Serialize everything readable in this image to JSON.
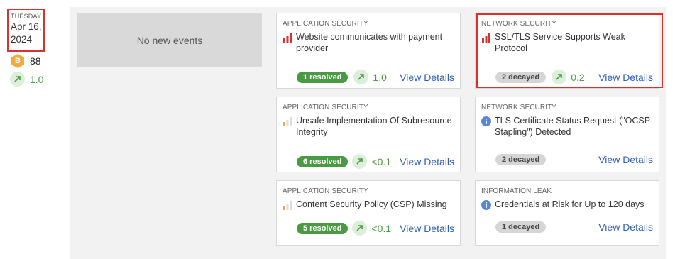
{
  "date": {
    "day_of_week": "TUESDAY",
    "date_text": "Apr 16, 2024"
  },
  "summary": {
    "grade": "B",
    "score": "88",
    "delta": "1.0"
  },
  "no_events": "No new events",
  "cards": [
    {
      "category": "APPLICATION SECURITY",
      "title": "Website communicates with payment provider",
      "severity": "high",
      "status": "1 resolved",
      "status_type": "resolved",
      "delta": "1.0",
      "link": "View Details"
    },
    {
      "category": "NETWORK SECURITY",
      "title": "SSL/TLS Service Supports Weak Protocol",
      "severity": "high",
      "status": "2 decayed",
      "status_type": "decayed",
      "delta": "0.2",
      "link": "View Details"
    },
    {
      "category": "APPLICATION SECURITY",
      "title": "Unsafe Implementation Of Subresource Integrity",
      "severity": "low",
      "status": "6 resolved",
      "status_type": "resolved",
      "delta": "<0.1",
      "link": "View Details"
    },
    {
      "category": "NETWORK SECURITY",
      "title": "TLS Certificate Status Request (\"OCSP Stapling\") Detected",
      "severity": "info",
      "status": "2 decayed",
      "status_type": "decayed",
      "delta": "",
      "link": "View Details"
    },
    {
      "category": "APPLICATION SECURITY",
      "title": "Content Security Policy (CSP) Missing",
      "severity": "low",
      "status": "5 resolved",
      "status_type": "resolved",
      "delta": "<0.1",
      "link": "View Details"
    },
    {
      "category": "INFORMATION LEAK",
      "title": "Credentials at Risk for Up to 120 days",
      "severity": "info",
      "status": "1 decayed",
      "status_type": "decayed",
      "delta": "",
      "link": "View Details"
    }
  ],
  "colors": {
    "accent_red": "#d9322e",
    "resolved_green": "#4a9a44",
    "link_blue": "#2f5fb8",
    "grade_orange": "#f3a93b",
    "info_blue": "#5b86d6"
  }
}
